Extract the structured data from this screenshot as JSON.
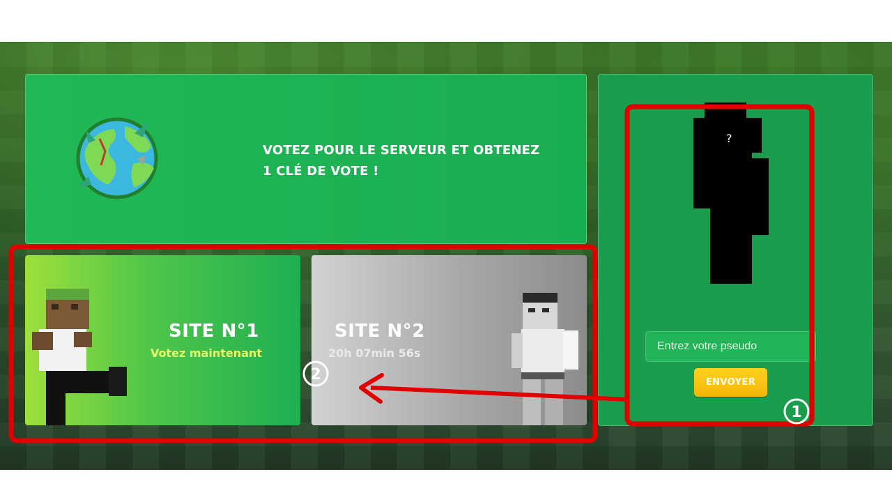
{
  "banner": {
    "title_line1": "VOTEZ POUR LE SERVEUR ET OBTENEZ",
    "title_line2": "1 CLÉ DE VOTE !"
  },
  "sites": [
    {
      "title": "SITE N°1",
      "subtitle": "Votez maintenant"
    },
    {
      "title": "SITE N°2",
      "subtitle": "20h 07min 56s"
    }
  ],
  "side_panel": {
    "skin_placeholder": "?",
    "input_placeholder": "Entrez votre pseudo",
    "send_label": "ENVOYER"
  },
  "annotations": {
    "step1": "1",
    "step2": "2",
    "highlight_color": "#e00000"
  }
}
